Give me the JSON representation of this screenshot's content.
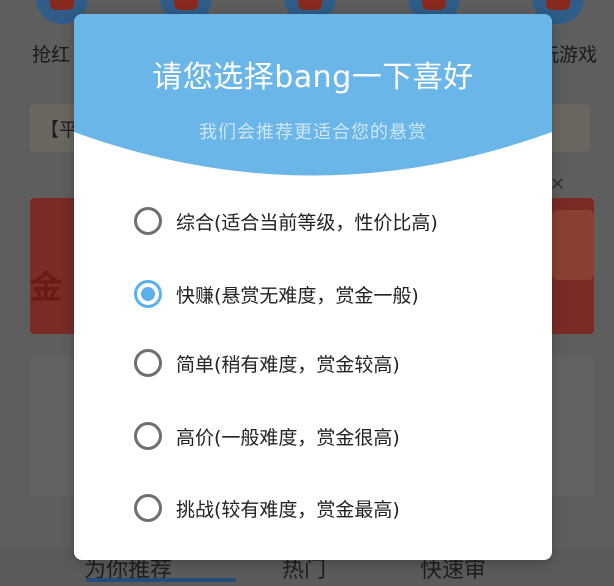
{
  "background": {
    "top_labels": [
      "抢红",
      "玩游戏"
    ],
    "notice_text": "【平",
    "banner_text": "金",
    "tabs": [
      "为你推荐",
      "热门",
      "快速审"
    ]
  },
  "dialog": {
    "title": "请您选择bang一下喜好",
    "subtitle": "我们会推荐更适合您的悬赏",
    "options": [
      {
        "label": "综合(适合当前等级，性价比高)",
        "checked": false
      },
      {
        "label": "快赚(悬赏无难度，赏金一般)",
        "checked": true
      },
      {
        "label": "简单(稍有难度，赏金较高)",
        "checked": false
      },
      {
        "label": "高价(一般难度，赏金很高)",
        "checked": false
      },
      {
        "label": "挑战(较有难度，赏金最高)",
        "checked": false
      }
    ]
  },
  "colors": {
    "accent": "#5ab0ea",
    "header_blue": "#6ab6e8",
    "overlay": "#4a4a4a"
  }
}
